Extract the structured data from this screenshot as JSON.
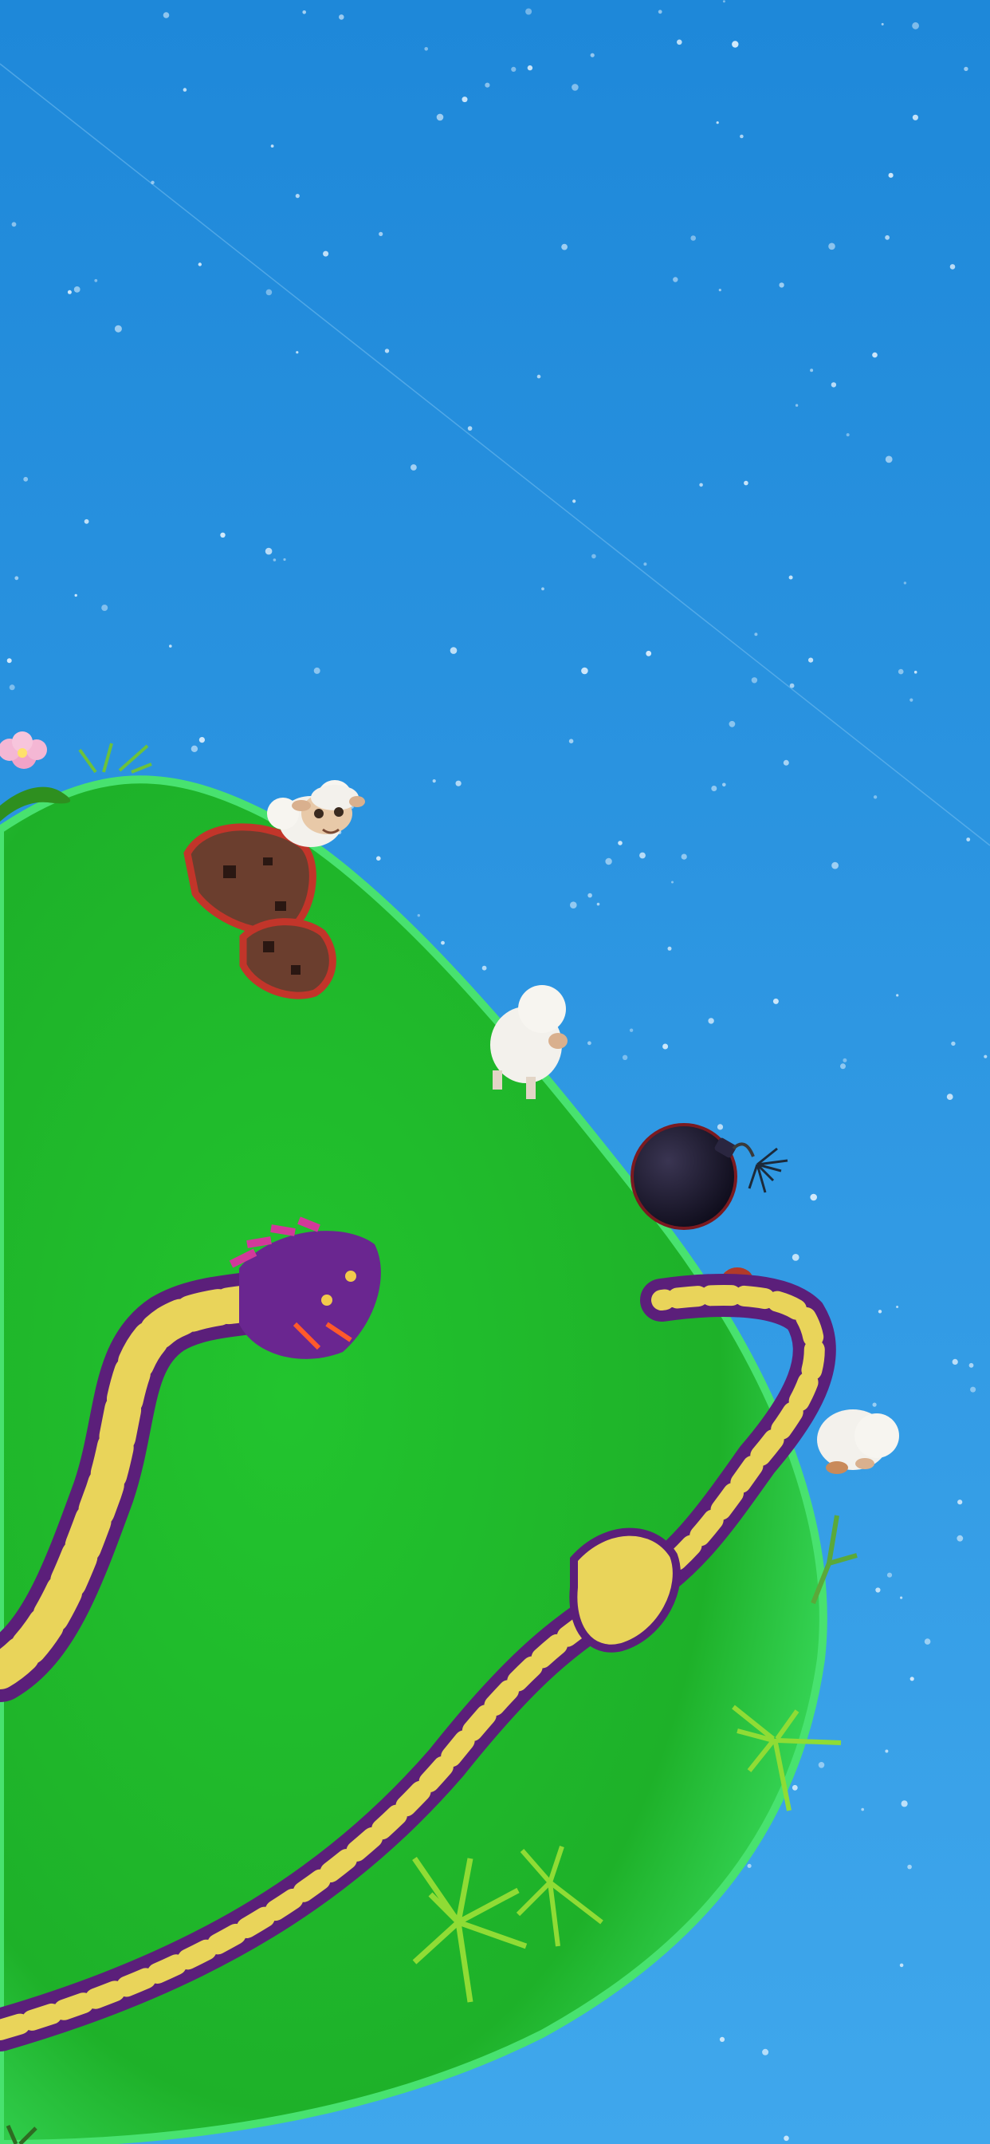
{
  "scene": {
    "type": "3d-game-scene",
    "hud_text": [],
    "colors": {
      "sky_top": "#1e88d9",
      "sky_bottom": "#3fa7ec",
      "planet": "#1fb82a",
      "planet_rim": "#44e06a",
      "snake_body": "#5b1f7a",
      "snake_scale": "#e9d45a",
      "bomb": "#1a1730",
      "sheep": "#f3f1ec",
      "rock": "#6b3e2e",
      "rock_rim": "#c2352a"
    },
    "elements": [
      {
        "name": "sky-background",
        "kind": "sky with stars"
      },
      {
        "name": "grass-planet",
        "kind": "green spherical planet"
      },
      {
        "name": "snake-1",
        "kind": "purple and yellow snake with spiked head"
      },
      {
        "name": "snake-2",
        "kind": "purple and yellow snake along planet edge"
      },
      {
        "name": "sheep",
        "count": 3
      },
      {
        "name": "bomb",
        "kind": "black bomb with lit fuse"
      },
      {
        "name": "rocks",
        "count": 2
      },
      {
        "name": "grass-tufts",
        "count": 4
      },
      {
        "name": "flower",
        "color": "pink"
      }
    ]
  }
}
